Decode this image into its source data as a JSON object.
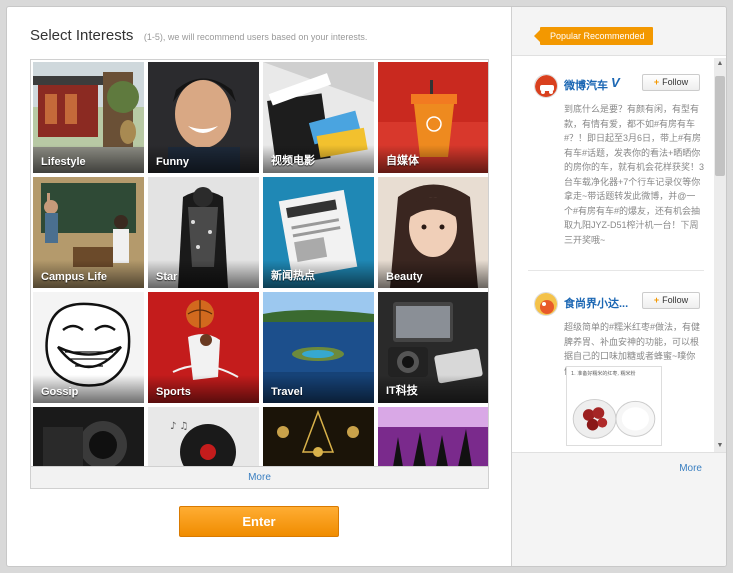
{
  "header": {
    "title": "Select Interests",
    "subtitle": "(1-5), we will recommend users based on your interests."
  },
  "interests": [
    {
      "label": "Lifestyle"
    },
    {
      "label": "Funny"
    },
    {
      "label": "视频电影"
    },
    {
      "label": "自媒体"
    },
    {
      "label": "Campus Life"
    },
    {
      "label": "Star"
    },
    {
      "label": "新闻热点"
    },
    {
      "label": "Beauty"
    },
    {
      "label": "Gossip"
    },
    {
      "label": "Sports"
    },
    {
      "label": "Travel"
    },
    {
      "label": "IT科技"
    }
  ],
  "more_label": "More",
  "enter_label": "Enter",
  "sidebar": {
    "tag": "Popular Recommended",
    "follow_label": "Follow",
    "more_label": "More",
    "users": [
      {
        "name": "微博汽车",
        "verified_mark": "V",
        "post": "到底什么是要？有颜有闲，有型有款，有情有爱，都不如#有房有车#？！即日起至3月6日，带上#有房有车#话题，发表你的看法+晒晒你的房你的车，就有机会花样获奖！3台车载净化器+7个行车记录仪等你拿走~带话题转发此微博，并@一个#有房有车#的爆友，还有机会抽取九阳JYZ-D51榨汁机一台！下周三开奖哦~"
      },
      {
        "name": "食尚界小达...",
        "post": "超级简单的#糯米红枣#做法，有健脾养胃、补血安神的功能，可以根据自己的口味加糖或者蜂蜜~噗你们",
        "image_caption": "1. 准备好糯米的红枣, 糯米粉"
      }
    ]
  },
  "colors": {
    "accent_orange": "#f39800",
    "link_blue": "#3a7fc1"
  }
}
